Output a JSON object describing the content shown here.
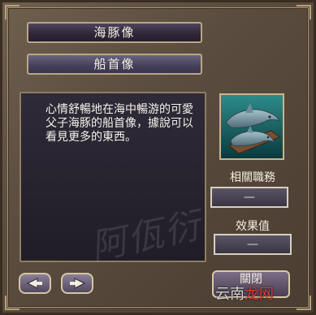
{
  "item": {
    "name": "海豚像",
    "category": "船首像",
    "description": "心情舒暢地在海中暢游的可愛父子海豚的船首像，據說可以看見更多的東西。",
    "watermark": "阿佤衍"
  },
  "stats": {
    "related_job_label": "相關職務",
    "related_job_value": "—",
    "effect_label": "效果值",
    "effect_value": "—"
  },
  "buttons": {
    "close_label": "關閉"
  },
  "site_watermark": {
    "prefix": "云南",
    "brand": "龙网"
  },
  "icons": {
    "prev": "left-arrow-icon",
    "next": "right-arrow-icon",
    "figurehead": "dolphin-figurehead-icon"
  }
}
